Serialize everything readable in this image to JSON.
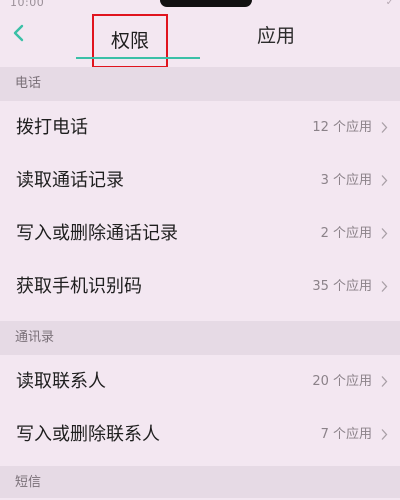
{
  "status_bar": {
    "time": "10:00",
    "indicators": "✓"
  },
  "header": {
    "back_icon": "chevron-left-icon",
    "tabs": [
      {
        "label": "权限",
        "selected": true
      },
      {
        "label": "应用",
        "selected": false
      }
    ],
    "accent_color": "#3ac0a7",
    "highlight_color": "#e0141e"
  },
  "sections": [
    {
      "title": "电话",
      "items": [
        {
          "label": "拨打电话",
          "count": "12 个应用"
        },
        {
          "label": "读取通话记录",
          "count": "3 个应用"
        },
        {
          "label": "写入或删除通话记录",
          "count": "2 个应用"
        },
        {
          "label": "获取手机识别码",
          "count": "35 个应用"
        }
      ]
    },
    {
      "title": "通讯录",
      "items": [
        {
          "label": "读取联系人",
          "count": "20 个应用"
        },
        {
          "label": "写入或删除联系人",
          "count": "7 个应用"
        }
      ]
    },
    {
      "title": "短信",
      "items": []
    }
  ]
}
